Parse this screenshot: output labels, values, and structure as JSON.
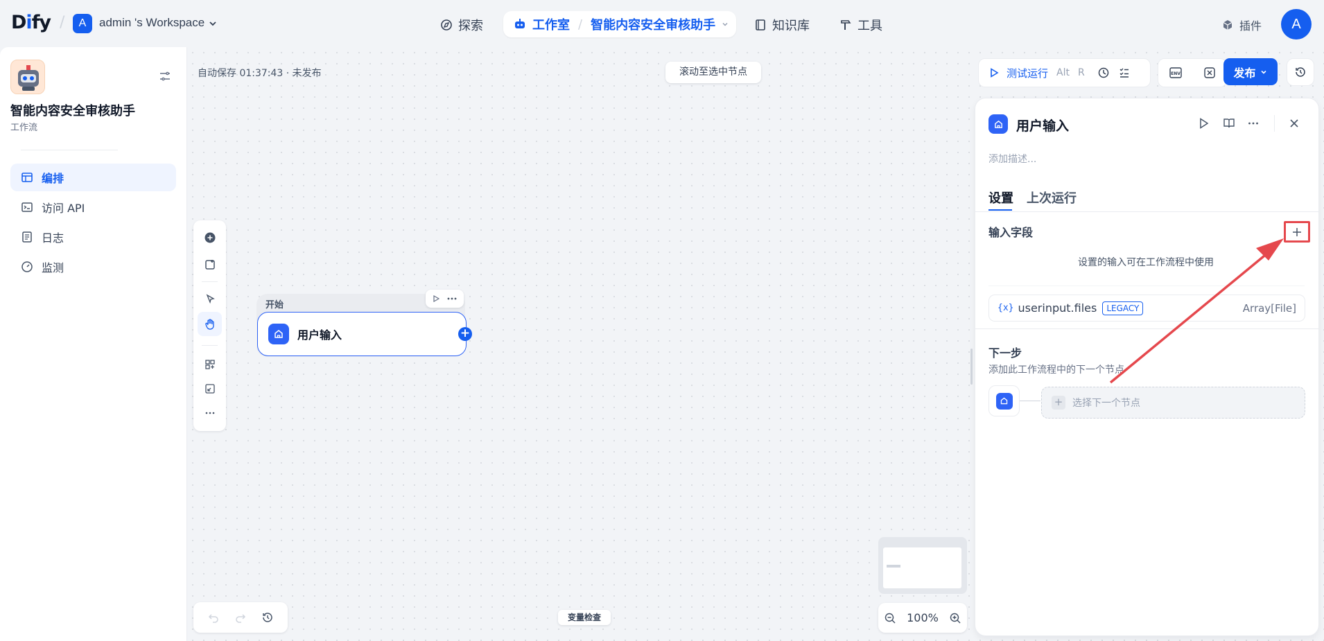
{
  "header": {
    "logo": "Dify",
    "workspace": {
      "badge": "A",
      "name": "admin 's Workspace"
    },
    "nav": {
      "explore": "探索",
      "studio": "工作室",
      "current_app": "智能内容安全审核助手",
      "knowledge": "知识库",
      "tools": "工具",
      "plugins": "插件"
    },
    "avatar": "A"
  },
  "sidebar": {
    "app_name": "智能内容安全审核助手",
    "app_type": "工作流",
    "items": [
      {
        "label": "编排",
        "icon": "layout-icon",
        "active": true
      },
      {
        "label": "访问 API",
        "icon": "terminal-icon",
        "active": false
      },
      {
        "label": "日志",
        "icon": "file-list-icon",
        "active": false
      },
      {
        "label": "监测",
        "icon": "dashboard-icon",
        "active": false
      }
    ]
  },
  "canvas": {
    "autosave": "自动保存 01:37:43 · 未发布",
    "scroll_to_node": "滚动至选中节点",
    "node": {
      "section_label": "开始",
      "title": "用户输入"
    },
    "var_inspect": "变量检查",
    "zoom": "100%"
  },
  "toolbar": {
    "test_run": "测试运行",
    "shortcut_alt": "Alt",
    "shortcut_key": "R",
    "publish": "发布"
  },
  "panel": {
    "title": "用户输入",
    "description_placeholder": "添加描述...",
    "tabs": [
      "设置",
      "上次运行"
    ],
    "input_fields_title": "输入字段",
    "input_fields_hint": "设置的输入可在工作流程中使用",
    "variables": [
      {
        "icon": "{x}",
        "name": "userinput.files",
        "badge": "LEGACY",
        "type": "Array[File]"
      }
    ],
    "next_step_title": "下一步",
    "next_step_desc": "添加此工作流程中的下一个节点",
    "next_select_placeholder": "选择下一个节点"
  },
  "colors": {
    "accent": "#155eef",
    "annotation": "#e5484d"
  }
}
